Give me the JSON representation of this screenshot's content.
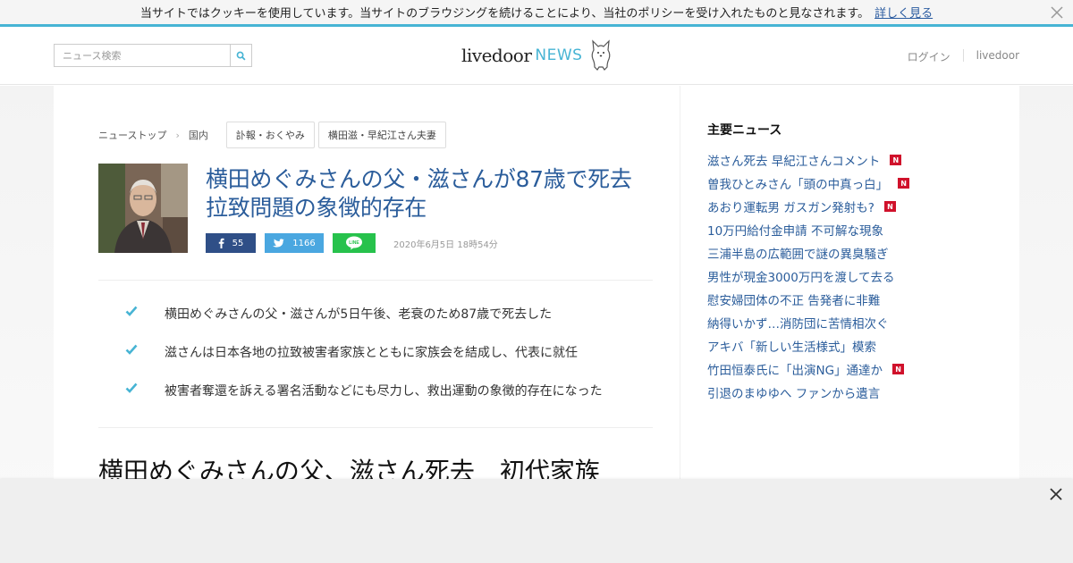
{
  "cookie_bar": {
    "message": "当サイトではクッキーを使用しています。当サイトのブラウジングを続けることにより、当社のポリシーを受け入れたものと見なされます。",
    "link": "詳しく見る",
    "close_icon": "close-icon"
  },
  "header": {
    "search_placeholder": "ニュース検索",
    "search_icon": "search-icon",
    "logo_livedoor": "livedoor",
    "logo_news": "NEWS",
    "logo_icon": "dog-mascot-icon",
    "login": "ログイン",
    "livedoor": "livedoor"
  },
  "breadcrumb": {
    "items": [
      "ニューストップ",
      "国内"
    ],
    "tags": [
      "訃報・おくやみ",
      "横田滋・早紀江さん夫妻"
    ]
  },
  "article": {
    "headline": "横田めぐみさんの父・滋さんが87歳で死去 拉致問題の象徴的存在",
    "share": {
      "facebook_count": "55",
      "twitter_count": "1166",
      "line_label": "LINE"
    },
    "date": "2020年6月5日 18時54分",
    "summary": [
      "横田めぐみさんの父・滋さんが5日午後、老衰のため87歳で死去した",
      "滋さんは日本各地の拉致被害者家族とともに家族会を結成し、代表に就任",
      "被害者奪還を訴える署名活動などにも尽力し、救出運動の象徴的存在になった"
    ],
    "title": "横田めぐみさんの父、滋さん死去　初代家族"
  },
  "sidebar": {
    "title": "主要ニュース",
    "items": [
      {
        "text": "滋さん死去 早紀江さんコメント",
        "new": true
      },
      {
        "text": "曽我ひとみさん「頭の中真っ白」",
        "new": true
      },
      {
        "text": "あおり運転男 ガスガン発射も?",
        "new": true
      },
      {
        "text": "10万円給付金申請 不可解な現象",
        "new": false
      },
      {
        "text": "三浦半島の広範囲で謎の異臭騒ぎ",
        "new": false
      },
      {
        "text": "男性が現金3000万円を渡して去る",
        "new": false
      },
      {
        "text": "慰安婦団体の不正 告発者に非難",
        "new": false
      },
      {
        "text": "納得いかず…消防団に苦情相次ぐ",
        "new": false
      },
      {
        "text": "アキバ「新しい生活様式」模索",
        "new": false
      },
      {
        "text": "竹田恒泰氏に「出演NG」通達か",
        "new": true
      },
      {
        "text": "引退のまゆゆへ ファンから遺言",
        "new": false
      }
    ],
    "new_badge": "N"
  },
  "colors": {
    "accent": "#47b4d4",
    "link": "#2b5d9b",
    "facebook": "#2f4f87",
    "twitter": "#4aa7e0",
    "line": "#27c24c",
    "new_badge": "#d0112b"
  }
}
